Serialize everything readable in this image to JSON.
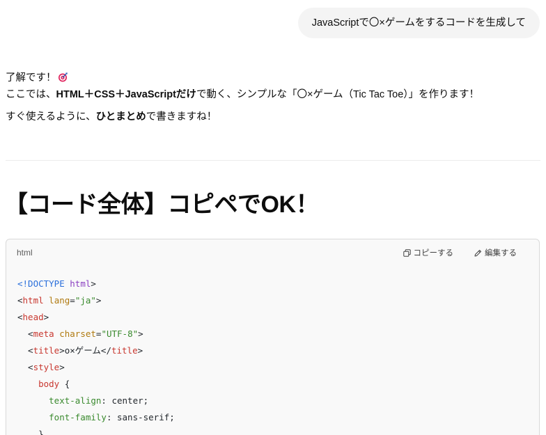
{
  "user_message": "JavaScriptで〇×ゲームをするコードを生成して",
  "assistant": {
    "line1_text": "了解です！",
    "line1_emoji": "target-emoji-icon",
    "line2": {
      "a": "ここでは、",
      "b": "HTML＋CSS＋JavaScriptだけ",
      "c": "で動く、シンプルな「〇×ゲーム（Tic Tac Toe）」を作ります！"
    },
    "line3": {
      "a": "すぐ使えるように、",
      "b": "ひとまとめ",
      "c": "で書きますね！"
    }
  },
  "heading": "【コード全体】コピペでOK！",
  "codeblock": {
    "language": "html",
    "copy_label": "コピーする",
    "edit_label": "編集する",
    "lines": [
      [
        {
          "t": "<!DOCTYPE ",
          "c": "c-doctype"
        },
        {
          "t": "html",
          "c": "c-kw"
        },
        {
          "t": ">",
          "c": "c-plain"
        }
      ],
      [
        {
          "t": "<",
          "c": "c-plain"
        },
        {
          "t": "html",
          "c": "c-tag"
        },
        {
          "t": " ",
          "c": "c-plain"
        },
        {
          "t": "lang",
          "c": "c-attr"
        },
        {
          "t": "=",
          "c": "c-plain"
        },
        {
          "t": "\"ja\"",
          "c": "c-str"
        },
        {
          "t": ">",
          "c": "c-plain"
        }
      ],
      [
        {
          "t": "<",
          "c": "c-plain"
        },
        {
          "t": "head",
          "c": "c-tag"
        },
        {
          "t": ">",
          "c": "c-plain"
        }
      ],
      [
        {
          "t": "  <",
          "c": "c-plain"
        },
        {
          "t": "meta",
          "c": "c-tag"
        },
        {
          "t": " ",
          "c": "c-plain"
        },
        {
          "t": "charset",
          "c": "c-attr"
        },
        {
          "t": "=",
          "c": "c-plain"
        },
        {
          "t": "\"UTF-8\"",
          "c": "c-str"
        },
        {
          "t": ">",
          "c": "c-plain"
        }
      ],
      [
        {
          "t": "  <",
          "c": "c-plain"
        },
        {
          "t": "title",
          "c": "c-tag"
        },
        {
          "t": ">o×ゲーム</",
          "c": "c-plain"
        },
        {
          "t": "title",
          "c": "c-tag"
        },
        {
          "t": ">",
          "c": "c-plain"
        }
      ],
      [
        {
          "t": "  <",
          "c": "c-plain"
        },
        {
          "t": "style",
          "c": "c-tag"
        },
        {
          "t": ">",
          "c": "c-plain"
        }
      ],
      [
        {
          "t": "    ",
          "c": "c-plain"
        },
        {
          "t": "body",
          "c": "c-sel"
        },
        {
          "t": " {",
          "c": "c-plain"
        }
      ],
      [
        {
          "t": "      ",
          "c": "c-plain"
        },
        {
          "t": "text-align",
          "c": "c-prop"
        },
        {
          "t": ": center;",
          "c": "c-plain"
        }
      ],
      [
        {
          "t": "      ",
          "c": "c-plain"
        },
        {
          "t": "font-family",
          "c": "c-prop"
        },
        {
          "t": ": sans-serif;",
          "c": "c-plain"
        }
      ],
      [
        {
          "t": "    }",
          "c": "c-plain"
        }
      ]
    ]
  }
}
